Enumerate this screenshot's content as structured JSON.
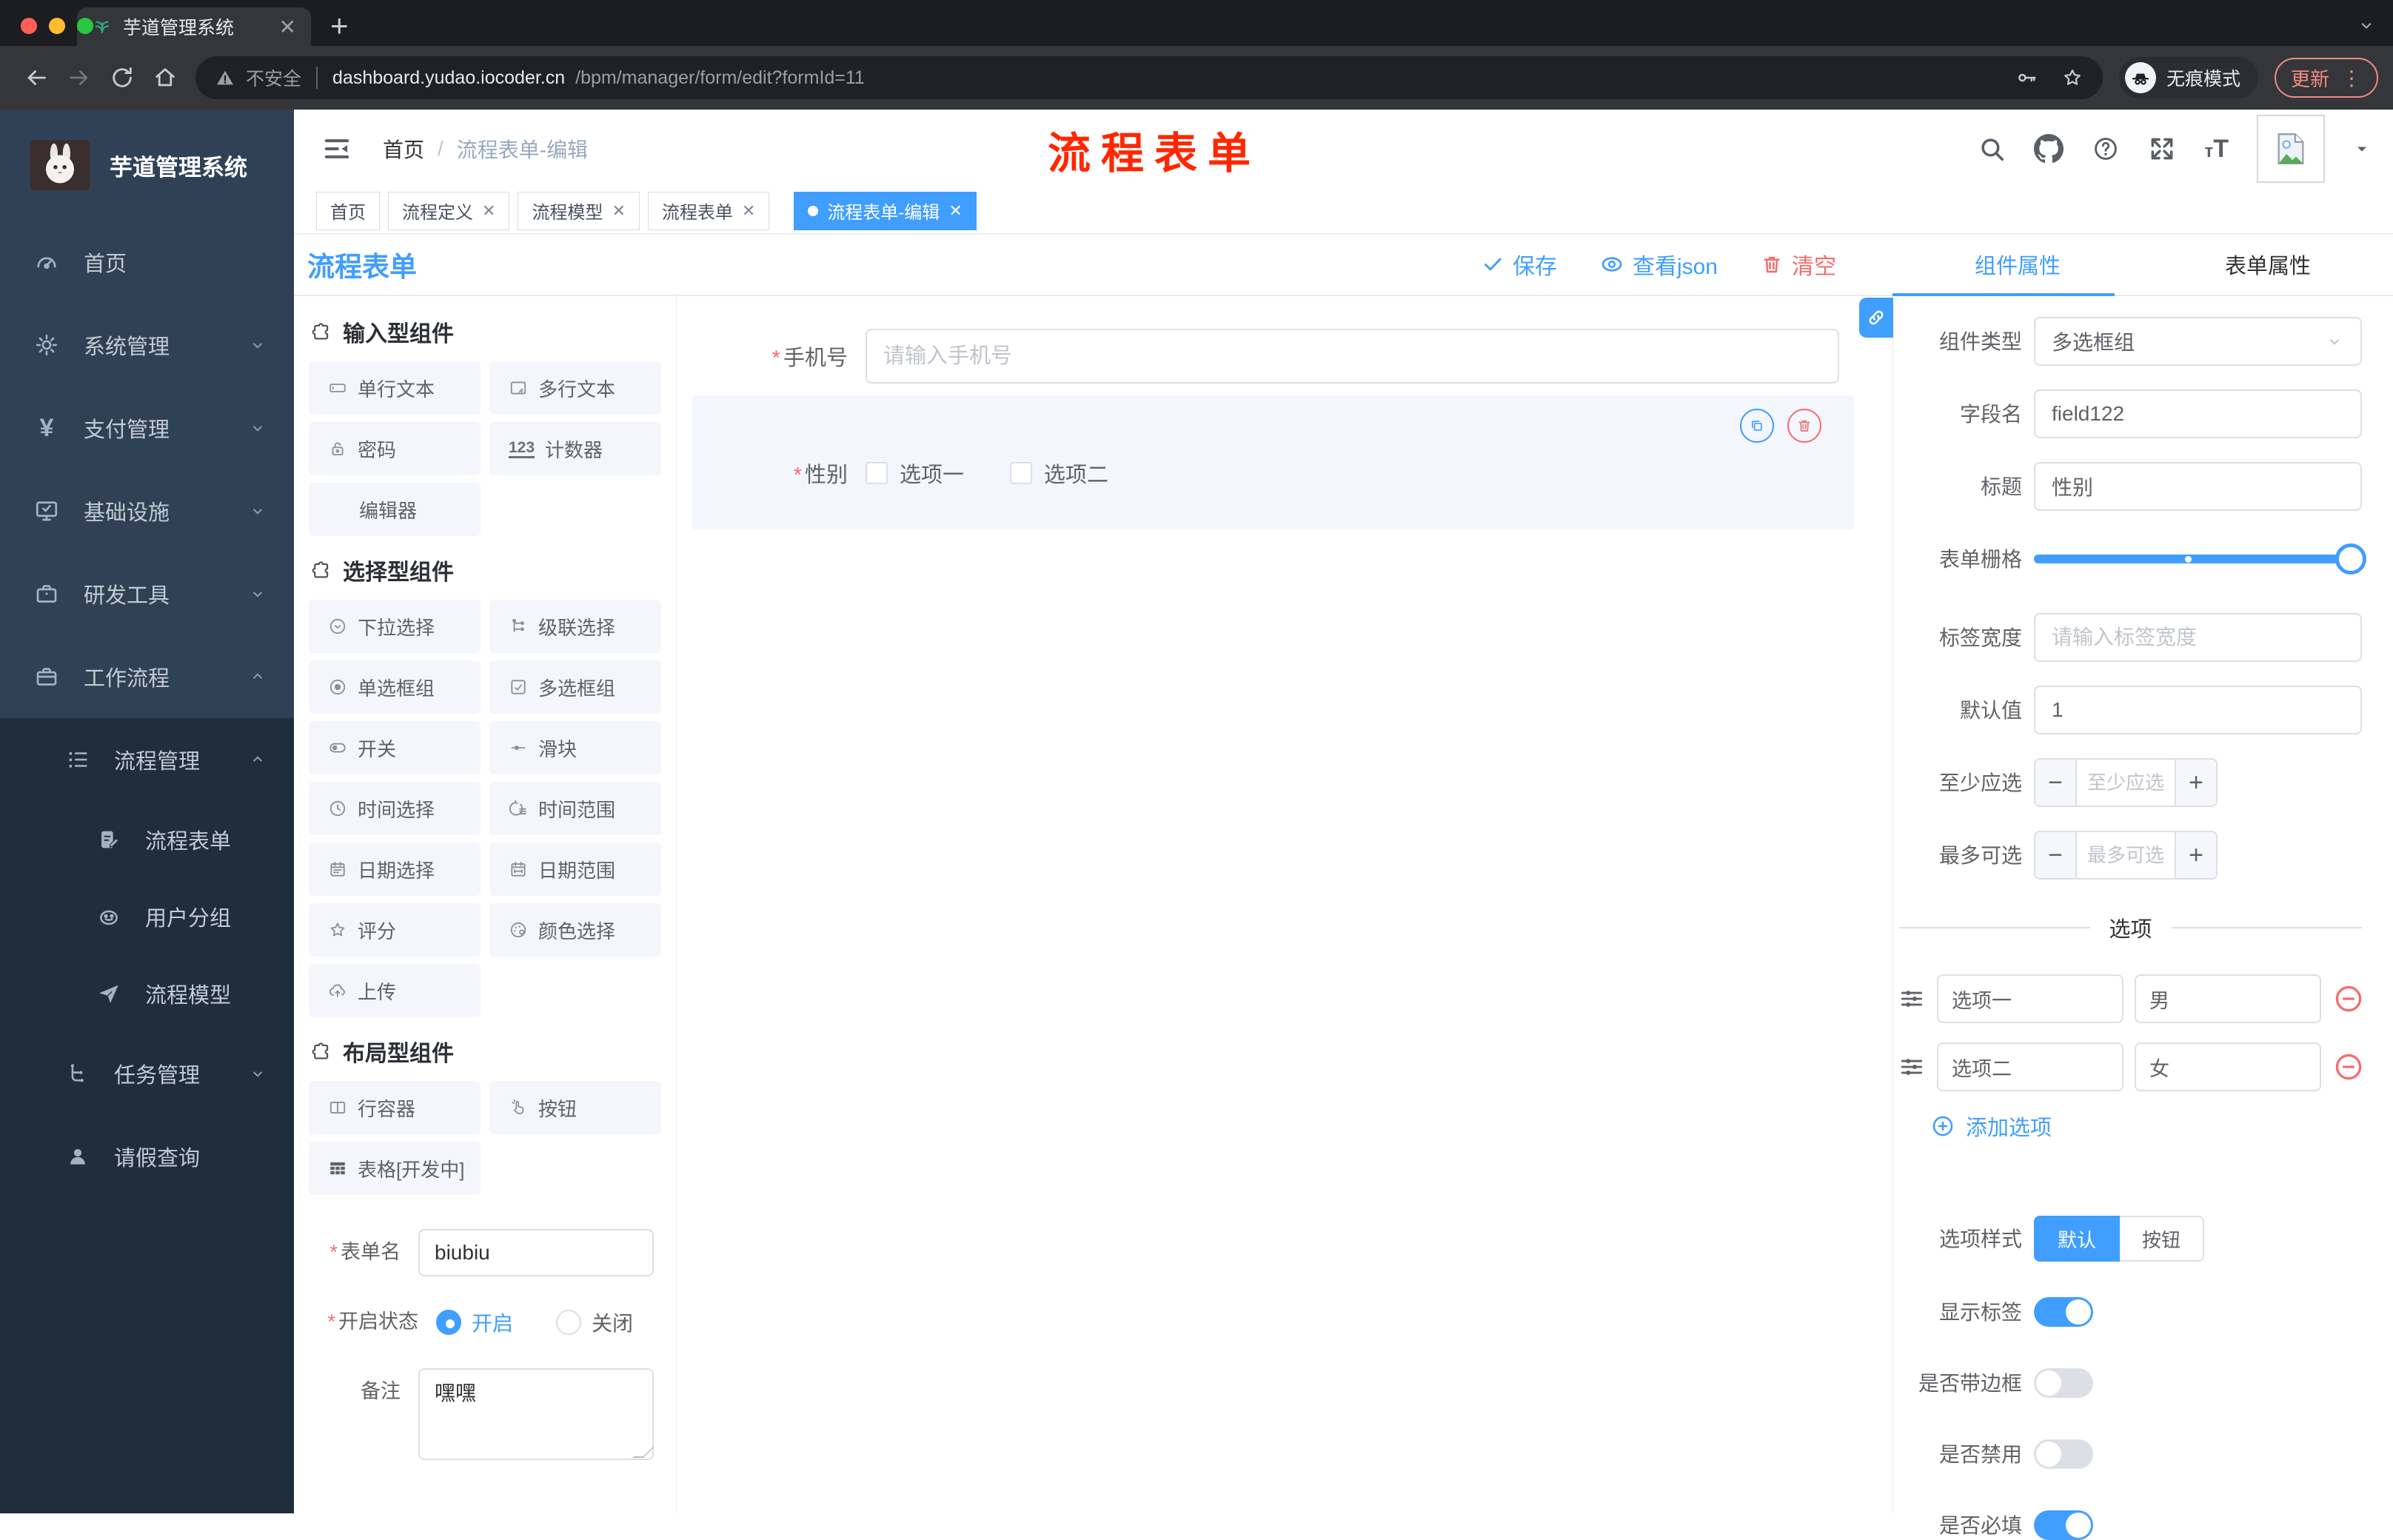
{
  "browser": {
    "tab_title": "芋道管理系统",
    "url": {
      "warning_label": "不安全",
      "host": "dashboard.yudao.iocoder.cn",
      "path": "/bpm/manager/form/edit?formId=11"
    },
    "incognito_label": "无痕模式",
    "update_label": "更新"
  },
  "sidebar": {
    "title": "芋道管理系统",
    "items": [
      {
        "label": "首页"
      },
      {
        "label": "系统管理"
      },
      {
        "label": "支付管理"
      },
      {
        "label": "基础设施"
      },
      {
        "label": "研发工具"
      },
      {
        "label": "工作流程"
      }
    ],
    "submenu": {
      "process_management": "流程管理",
      "children": [
        "流程表单",
        "用户分组",
        "流程模型"
      ],
      "task_management": "任务管理",
      "leave_query": "请假查询"
    }
  },
  "header": {
    "breadcrumb": [
      "首页",
      "流程表单-编辑"
    ],
    "annotation": "流程表单"
  },
  "tags": [
    {
      "label": "首页"
    },
    {
      "label": "流程定义"
    },
    {
      "label": "流程模型"
    },
    {
      "label": "流程表单"
    },
    {
      "label": "流程表单-编辑"
    }
  ],
  "designer": {
    "title": "流程表单",
    "save": "保存",
    "view_json": "查看json",
    "clear": "清空"
  },
  "components": {
    "sections": [
      {
        "title": "输入型组件",
        "items": [
          {
            "label": "单行文本"
          },
          {
            "label": "多行文本"
          },
          {
            "label": "密码"
          },
          {
            "label": "计数器",
            "badge": "123"
          },
          {
            "label": "编辑器"
          }
        ]
      },
      {
        "title": "选择型组件",
        "items": [
          {
            "label": "下拉选择"
          },
          {
            "label": "级联选择"
          },
          {
            "label": "单选框组"
          },
          {
            "label": "多选框组"
          },
          {
            "label": "开关"
          },
          {
            "label": "滑块"
          },
          {
            "label": "时间选择"
          },
          {
            "label": "时间范围"
          },
          {
            "label": "日期选择"
          },
          {
            "label": "日期范围"
          },
          {
            "label": "评分"
          },
          {
            "label": "颜色选择"
          },
          {
            "label": "上传"
          }
        ]
      },
      {
        "title": "布局型组件",
        "items": [
          {
            "label": "行容器"
          },
          {
            "label": "按钮"
          },
          {
            "label": "表格[开发中]"
          }
        ]
      }
    ]
  },
  "form_meta": {
    "name_label": "表单名",
    "name_value": "biubiu",
    "status_label": "开启状态",
    "status_on": "开启",
    "status_off": "关闭",
    "remark_label": "备注",
    "remark_value": "嘿嘿"
  },
  "canvas": {
    "phone": {
      "label": "手机号",
      "placeholder": "请输入手机号"
    },
    "gender": {
      "label": "性别",
      "options": [
        "选项一",
        "选项二"
      ]
    }
  },
  "panel": {
    "tabs": [
      "组件属性",
      "表单属性"
    ],
    "component_type": {
      "label": "组件类型",
      "value": "多选框组"
    },
    "field_name": {
      "label": "字段名",
      "value": "field122"
    },
    "title_field": {
      "label": "标题",
      "value": "性别"
    },
    "grid": {
      "label": "表单栅格"
    },
    "label_width": {
      "label": "标签宽度",
      "placeholder": "请输入标签宽度"
    },
    "default_value": {
      "label": "默认值",
      "value": "1"
    },
    "min_select": {
      "label": "至少应选",
      "placeholder": "至少应选"
    },
    "max_select": {
      "label": "最多可选",
      "placeholder": "最多可选"
    },
    "options": {
      "title": "选项",
      "rows": [
        {
          "label": "选项一",
          "value": "男"
        },
        {
          "label": "选项二",
          "value": "女"
        }
      ],
      "add_label": "添加选项"
    },
    "option_style": {
      "label": "选项样式",
      "choices": [
        "默认",
        "按钮"
      ],
      "active": "默认"
    },
    "toggles": [
      {
        "label": "显示标签",
        "on": true
      },
      {
        "label": "是否带边框",
        "on": false
      },
      {
        "label": "是否禁用",
        "on": false
      },
      {
        "label": "是否必填",
        "on": true
      }
    ]
  },
  "colors": {
    "primary": "#409eff",
    "danger": "#f56c6c",
    "sidebar_bg": "#304156",
    "submenu_bg": "#1f2d3d",
    "annotation_red": "#ff2600"
  }
}
